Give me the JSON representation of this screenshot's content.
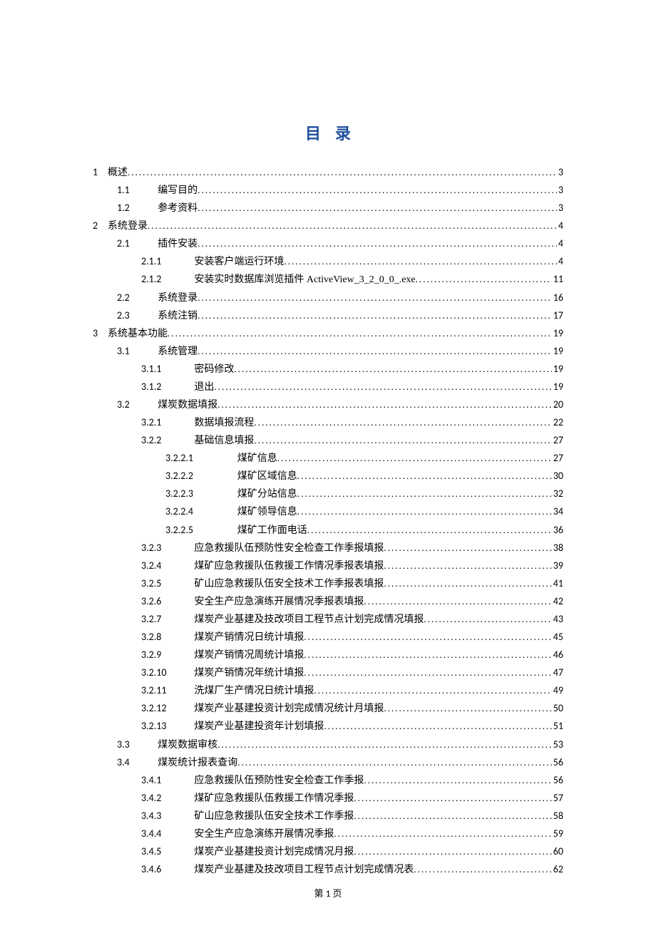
{
  "title": "目录",
  "footer": {
    "prefix": "第",
    "num": "1",
    "suffix": "页"
  },
  "toc": [
    {
      "level": 1,
      "num": "1",
      "label": "概述",
      "page": "3"
    },
    {
      "level": 2,
      "num": "1.1",
      "label": "编写目的",
      "page": "3"
    },
    {
      "level": 2,
      "num": "1.2",
      "label": "参考资料",
      "page": "3"
    },
    {
      "level": 1,
      "num": "2",
      "label": "系统登录",
      "page": "4"
    },
    {
      "level": 2,
      "num": "2.1",
      "label": "插件安装",
      "page": "4"
    },
    {
      "level": 3,
      "num": "2.1.1",
      "label": "安装客户端运行环境",
      "page": "4"
    },
    {
      "level": 3,
      "num": "2.1.2",
      "label": "安装实时数据库浏览插件 ActiveView_3_2_0_0_.exe",
      "page": "11"
    },
    {
      "level": 2,
      "num": "2.2",
      "label": "系统登录",
      "page": "16"
    },
    {
      "level": 2,
      "num": "2.3",
      "label": "系统注销",
      "page": "17"
    },
    {
      "level": 1,
      "num": "3",
      "label": "系统基本功能",
      "page": "19"
    },
    {
      "level": 2,
      "num": "3.1",
      "label": "系统管理",
      "page": "19"
    },
    {
      "level": 3,
      "num": "3.1.1",
      "label": "密码修改",
      "page": "19"
    },
    {
      "level": 3,
      "num": "3.1.2",
      "label": "退出",
      "page": "19"
    },
    {
      "level": 2,
      "num": "3.2",
      "label": "煤炭数据填报",
      "page": "20"
    },
    {
      "level": 3,
      "num": "3.2.1",
      "label": "数据填报流程",
      "page": "22"
    },
    {
      "level": 3,
      "num": "3.2.2",
      "label": "基础信息填报",
      "page": "27"
    },
    {
      "level": 4,
      "num": "3.2.2.1",
      "label": "煤矿信息",
      "page": "27"
    },
    {
      "level": 4,
      "num": "3.2.2.2",
      "label": "煤矿区域信息",
      "page": "30"
    },
    {
      "level": 4,
      "num": "3.2.2.3",
      "label": "煤矿分站信息",
      "page": "32"
    },
    {
      "level": 4,
      "num": "3.2.2.4",
      "label": "煤矿领导信息",
      "page": "34"
    },
    {
      "level": 4,
      "num": "3.2.2.5",
      "label": "煤矿工作面电话",
      "page": "36"
    },
    {
      "level": 3,
      "num": "3.2.3",
      "label": "应急救援队伍预防性安全检查工作季报填报",
      "page": "38"
    },
    {
      "level": 3,
      "num": "3.2.4",
      "label": "煤矿应急救援队伍救援工作情况季报表填报",
      "page": "39"
    },
    {
      "level": 3,
      "num": "3.2.5",
      "label": "矿山应急救援队伍安全技术工作季报表填报",
      "page": "41"
    },
    {
      "level": 3,
      "num": "3.2.6",
      "label": "安全生产应急演练开展情况季报表填报",
      "page": "42"
    },
    {
      "level": 3,
      "num": "3.2.7",
      "label": "煤炭产业基建及技改项目工程节点计划完成情况填报",
      "page": "43"
    },
    {
      "level": 3,
      "num": "3.2.8",
      "label": "煤炭产销情况日统计填报",
      "page": "45"
    },
    {
      "level": 3,
      "num": "3.2.9",
      "label": "煤炭产销情况周统计填报",
      "page": "46"
    },
    {
      "level": 3,
      "num": "3.2.10",
      "label": "煤炭产销情况年统计填报",
      "page": "47"
    },
    {
      "level": 3,
      "num": "3.2.11",
      "label": "洗煤厂生产情况日统计填报",
      "page": "49"
    },
    {
      "level": 3,
      "num": "3.2.12",
      "label": "煤炭产业基建投资计划完成情况统计月填报",
      "page": "50"
    },
    {
      "level": 3,
      "num": "3.2.13",
      "label": "煤炭产业基建投资年计划填报",
      "page": "51"
    },
    {
      "level": 2,
      "num": "3.3",
      "label": "煤炭数据审核",
      "page": "53"
    },
    {
      "level": 2,
      "num": "3.4",
      "label": "煤炭统计报表查询",
      "page": "56"
    },
    {
      "level": 3,
      "num": "3.4.1",
      "label": "应急救援队伍预防性安全检查工作季报",
      "page": "56"
    },
    {
      "level": 3,
      "num": "3.4.2",
      "label": "煤矿应急救援队伍救援工作情况季报",
      "page": "57"
    },
    {
      "level": 3,
      "num": "3.4.3",
      "label": "矿山应急救援队伍安全技术工作季报",
      "page": "58"
    },
    {
      "level": 3,
      "num": "3.4.4",
      "label": "安全生产应急演练开展情况季报",
      "page": "59"
    },
    {
      "level": 3,
      "num": "3.4.5",
      "label": "煤炭产业基建投资计划完成情况月报",
      "page": "60"
    },
    {
      "level": 3,
      "num": "3.4.6",
      "label": "煤炭产业基建及技改项目工程节点计划完成情况表",
      "page": "62"
    }
  ]
}
